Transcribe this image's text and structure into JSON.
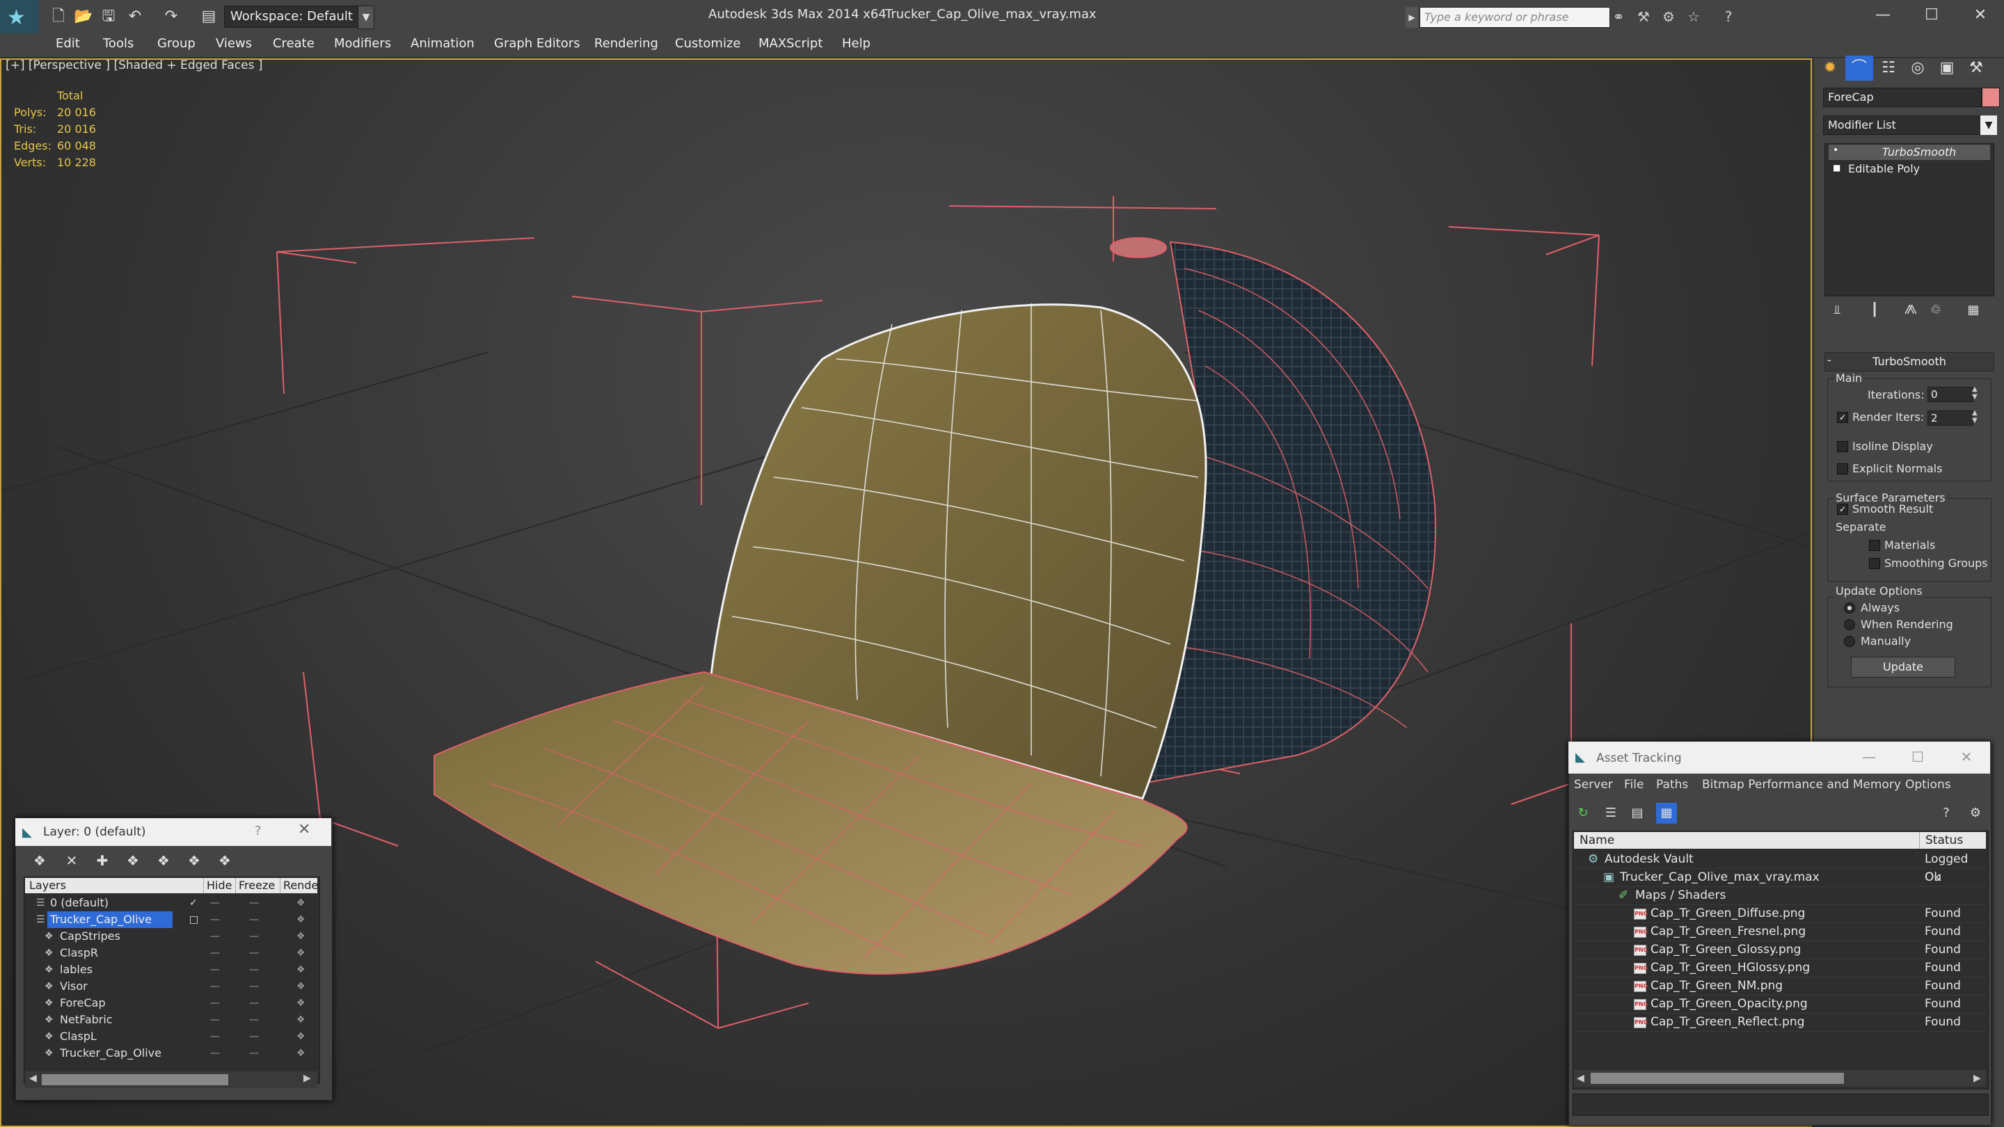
{
  "titlebar": {
    "workspace_label": "Workspace: Default",
    "app_title": "Autodesk 3ds Max  2014 x64",
    "file_title": "Trucker_Cap_Olive_max_vray.max",
    "search_placeholder": "Type a keyword or phrase"
  },
  "menu": [
    "Edit",
    "Tools",
    "Group",
    "Views",
    "Create",
    "Modifiers",
    "Animation",
    "Graph Editors",
    "Rendering",
    "Customize",
    "MAXScript",
    "Help"
  ],
  "viewport": {
    "label": "[+] [Perspective ] [Shaded + Edged Faces ]",
    "stats": {
      "header": "Total",
      "rows": [
        {
          "label": "Polys:",
          "value": "20 016"
        },
        {
          "label": "Tris:",
          "value": "20 016"
        },
        {
          "label": "Edges:",
          "value": "60 048"
        },
        {
          "label": "Verts:",
          "value": "10 228"
        }
      ]
    }
  },
  "command_panel": {
    "object_name": "ForeCap",
    "object_color": "#e88a8a",
    "modifier_list": "Modifier List",
    "stack": [
      "TurboSmooth",
      "Editable Poly"
    ],
    "rollout_title": "TurboSmooth",
    "main_group": "Main",
    "iterations_label": "Iterations:",
    "iterations_value": "0",
    "render_iters_label": "Render Iters:",
    "render_iters_value": "2",
    "isoline_label": "Isoline Display",
    "explicit_label": "Explicit Normals",
    "surface_group": "Surface Parameters",
    "smooth_label": "Smooth Result",
    "separate_label": "Separate",
    "materials_label": "Materials",
    "smoothing_label": "Smoothing Groups",
    "update_group": "Update Options",
    "always_label": "Always",
    "when_rendering_label": "When Rendering",
    "manually_label": "Manually",
    "update_button": "Update"
  },
  "layers": {
    "title": "Layer: 0 (default)",
    "help": "?",
    "columns": [
      "Layers",
      "Hide",
      "Freeze",
      "Rende"
    ],
    "rows": [
      {
        "name": "0 (default)",
        "selected": false,
        "indent": 0
      },
      {
        "name": "Trucker_Cap_Olive",
        "selected": true,
        "indent": 0
      },
      {
        "name": "CapStripes",
        "selected": false,
        "indent": 1
      },
      {
        "name": "ClaspR",
        "selected": false,
        "indent": 1
      },
      {
        "name": "lables",
        "selected": false,
        "indent": 1
      },
      {
        "name": "Visor",
        "selected": false,
        "indent": 1
      },
      {
        "name": "ForeCap",
        "selected": false,
        "indent": 1
      },
      {
        "name": "NetFabric",
        "selected": false,
        "indent": 1
      },
      {
        "name": "ClaspL",
        "selected": false,
        "indent": 1
      },
      {
        "name": "Trucker_Cap_Olive",
        "selected": false,
        "indent": 1
      }
    ]
  },
  "asset_tracking": {
    "title": "Asset Tracking",
    "menu": [
      "Server",
      "File",
      "Paths",
      "Bitmap Performance and Memory",
      "Options"
    ],
    "columns": [
      "Name",
      "Status"
    ],
    "rows": [
      {
        "name": "Autodesk Vault",
        "status": "Logged Ou",
        "indent": 0,
        "type": "vault"
      },
      {
        "name": "Trucker_Cap_Olive_max_vray.max",
        "status": "Ok",
        "indent": 1,
        "type": "max"
      },
      {
        "name": "Maps / Shaders",
        "status": "",
        "indent": 2,
        "type": "folder"
      },
      {
        "name": "Cap_Tr_Green_Diffuse.png",
        "status": "Found",
        "indent": 3,
        "type": "png"
      },
      {
        "name": "Cap_Tr_Green_Fresnel.png",
        "status": "Found",
        "indent": 3,
        "type": "png"
      },
      {
        "name": "Cap_Tr_Green_Glossy.png",
        "status": "Found",
        "indent": 3,
        "type": "png"
      },
      {
        "name": "Cap_Tr_Green_HGlossy.png",
        "status": "Found",
        "indent": 3,
        "type": "png"
      },
      {
        "name": "Cap_Tr_Green_NM.png",
        "status": "Found",
        "indent": 3,
        "type": "png"
      },
      {
        "name": "Cap_Tr_Green_Opacity.png",
        "status": "Found",
        "indent": 3,
        "type": "png"
      },
      {
        "name": "Cap_Tr_Green_Reflect.png",
        "status": "Found",
        "indent": 3,
        "type": "png"
      }
    ]
  },
  "colors": {
    "viewport_border": "#c8a23a",
    "stats": "#e6c64a",
    "wire": "#e0606a",
    "selection": "#2f6bd6"
  }
}
